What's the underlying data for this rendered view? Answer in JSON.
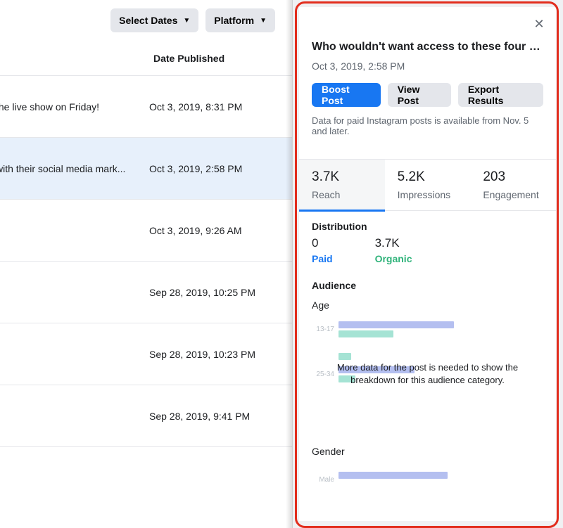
{
  "filters": {
    "dates_label": "Select Dates",
    "platform_label": "Platform"
  },
  "table": {
    "header_date": "Date Published",
    "rows": [
      {
        "title": "the live show on Friday!",
        "date": "Oct 3, 2019, 8:31 PM",
        "selected": false
      },
      {
        "title": "with their social media mark...",
        "date": "Oct 3, 2019, 2:58 PM",
        "selected": true
      },
      {
        "title": "",
        "date": "Oct 3, 2019, 9:26 AM",
        "selected": false
      },
      {
        "title": "",
        "date": "Sep 28, 2019, 10:25 PM",
        "selected": false
      },
      {
        "title": "",
        "date": "Sep 28, 2019, 10:23 PM",
        "selected": false
      },
      {
        "title": "",
        "date": "Sep 28, 2019, 9:41 PM",
        "selected": false
      }
    ]
  },
  "panel": {
    "title": "Who wouldn't want access to these four (slightl…",
    "timestamp": "Oct 3, 2019, 2:58 PM",
    "buttons": {
      "boost": "Boost Post",
      "view": "View Post",
      "export": "Export Results"
    },
    "note": "Data for paid Instagram posts is available from Nov. 5 and later.",
    "metrics": {
      "reach": {
        "value": "3.7K",
        "label": "Reach"
      },
      "impressions": {
        "value": "5.2K",
        "label": "Impressions"
      },
      "engagement": {
        "value": "203",
        "label": "Engagement"
      }
    },
    "distribution": {
      "heading": "Distribution",
      "paid": {
        "value": "0",
        "label": "Paid"
      },
      "organic": {
        "value": "3.7K",
        "label": "Organic"
      }
    },
    "audience": {
      "heading": "Audience",
      "age_label": "Age",
      "gender_label": "Gender",
      "overlay_msg": "More data for the post is needed to show the breakdown for this audience category."
    }
  },
  "chart_data": {
    "age": {
      "type": "bar",
      "categories": [
        "13-17",
        "25-34",
        "Male"
      ],
      "series": [
        {
          "name": "primary",
          "values_pct": [
            55,
            36,
            52
          ]
        },
        {
          "name": "secondary",
          "values_pct": [
            26,
            8,
            0
          ]
        }
      ],
      "note": "Axis not labeled; values are estimated bar widths as percent of axis max."
    }
  },
  "age_rows": [
    {
      "label": "13-17",
      "w1": 55,
      "w2": 26
    },
    {
      "label": "",
      "w1": 0,
      "w2": 6
    },
    {
      "label": "25-34",
      "w1": 36,
      "w2": 8
    },
    {
      "label": "",
      "w1": 0,
      "w2": 0
    }
  ],
  "gender_rows": [
    {
      "label": "Male",
      "w1": 52,
      "w2": 0
    }
  ]
}
